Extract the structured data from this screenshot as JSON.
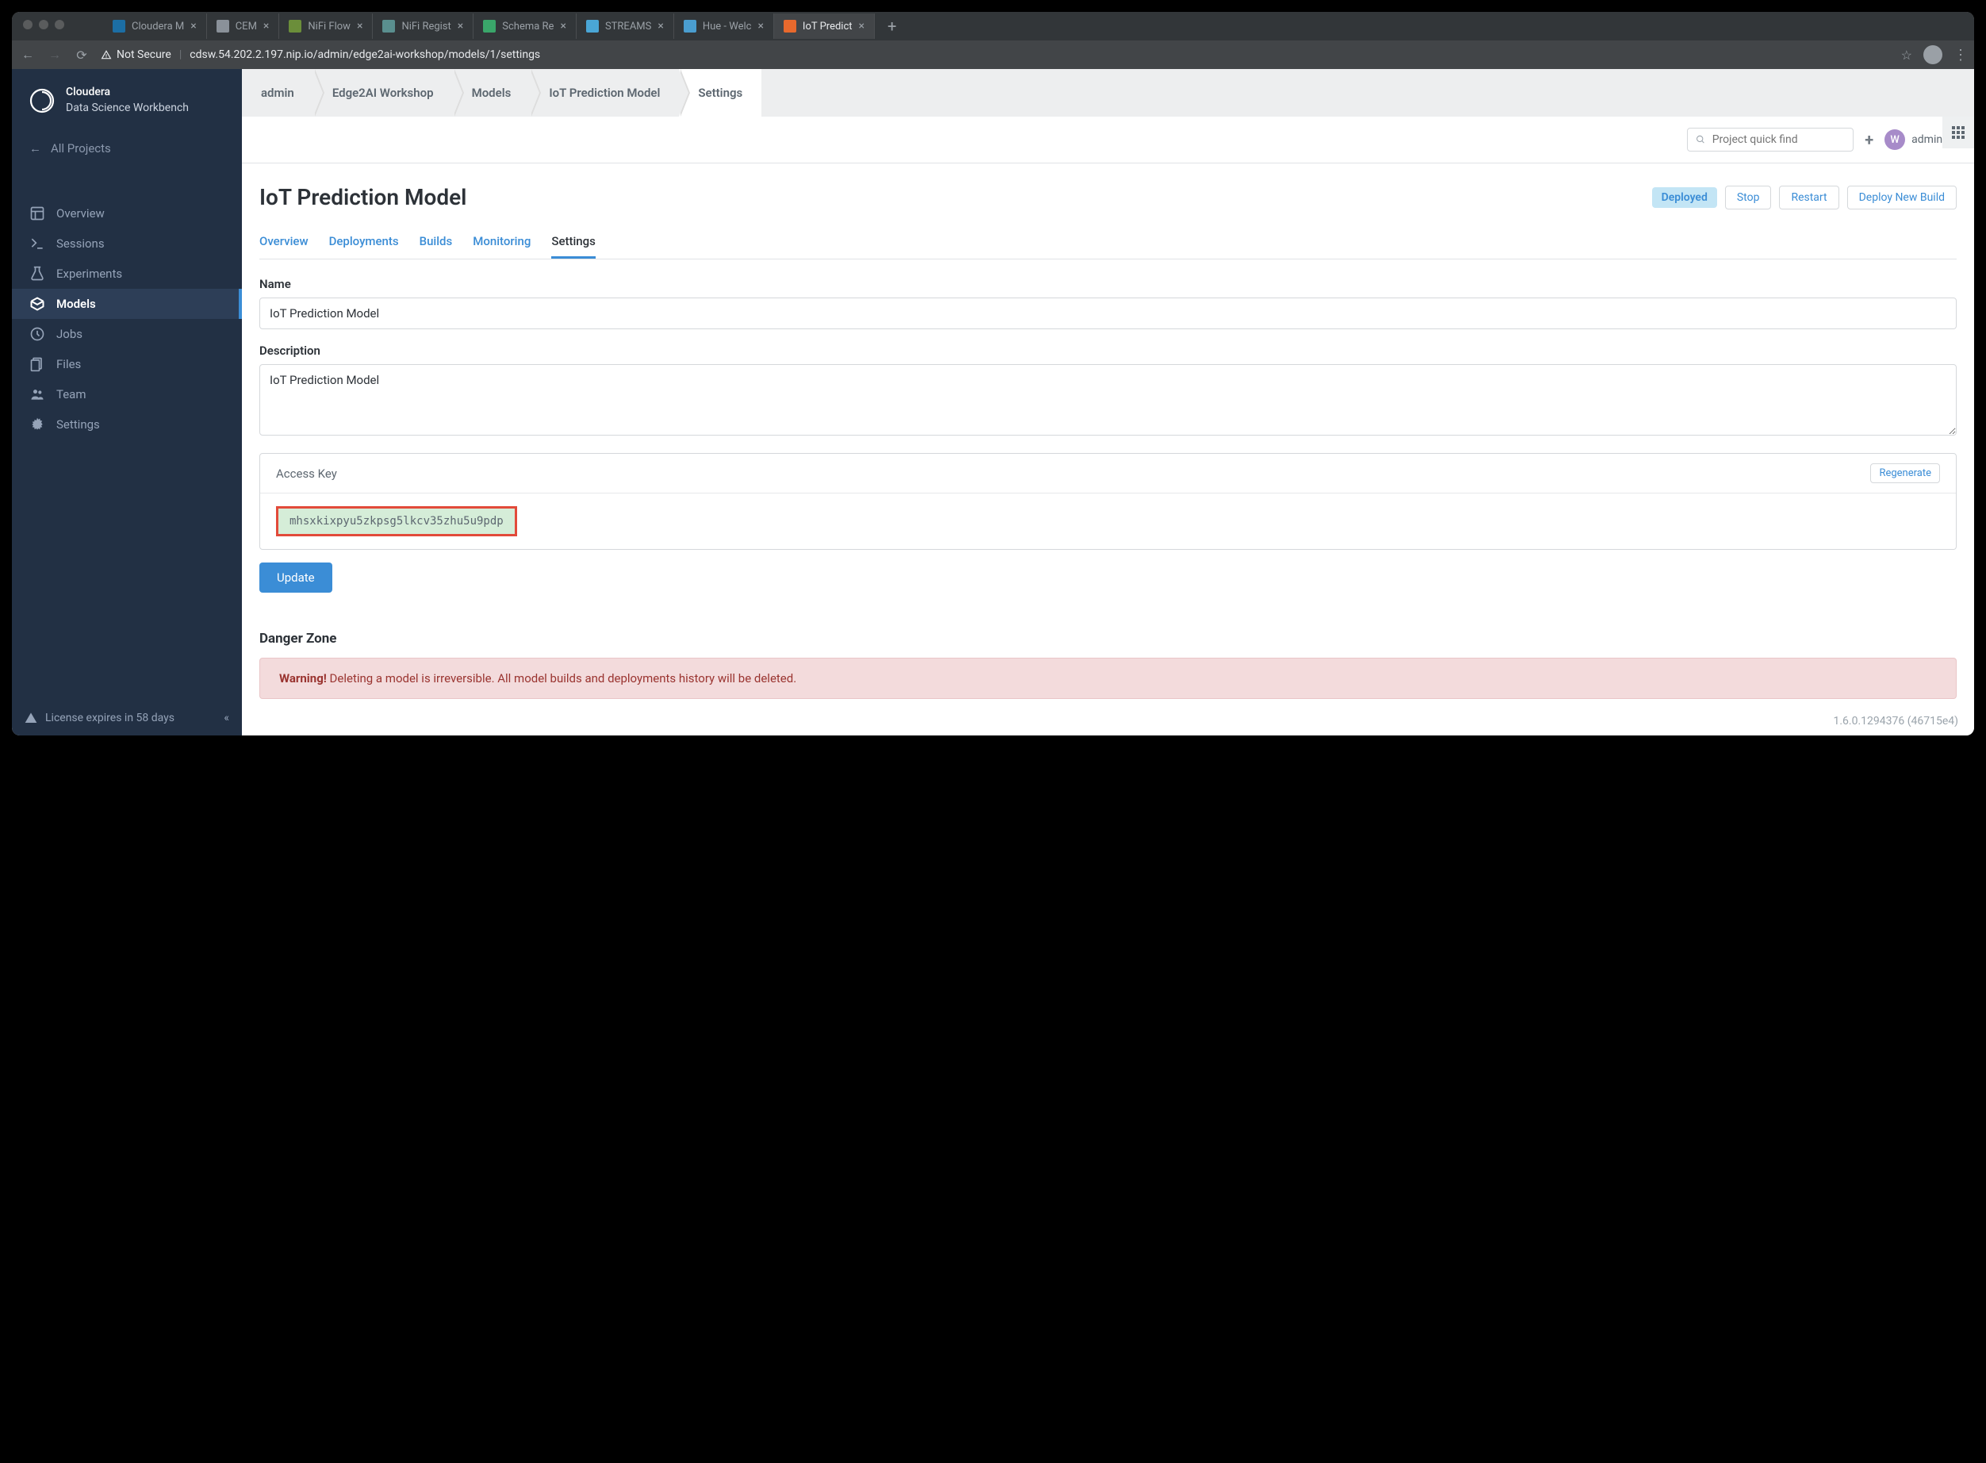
{
  "browser": {
    "tabs": [
      {
        "title": "Cloudera M",
        "favcolor": "#1c6ea4"
      },
      {
        "title": "CEM",
        "favcolor": "#8a9199"
      },
      {
        "title": "NiFi Flow",
        "favcolor": "#6b8e3a"
      },
      {
        "title": "NiFi Regist",
        "favcolor": "#5a8f8f"
      },
      {
        "title": "Schema Re",
        "favcolor": "#3aa66a"
      },
      {
        "title": "STREAMS",
        "favcolor": "#4aa6d6"
      },
      {
        "title": "Hue - Welc",
        "favcolor": "#4a9dcf"
      },
      {
        "title": "IoT Predict",
        "favcolor": "#e8692d",
        "active": true
      }
    ],
    "not_secure": "Not Secure",
    "url": "cdsw.54.202.2.197.nip.io/admin/edge2ai-workshop/models/1/settings"
  },
  "brand": {
    "line1": "Cloudera",
    "line2": "Data Science Workbench"
  },
  "all_projects": "All Projects",
  "sidebar": {
    "items": [
      {
        "label": "Overview",
        "icon": "overview"
      },
      {
        "label": "Sessions",
        "icon": "sessions"
      },
      {
        "label": "Experiments",
        "icon": "experiments"
      },
      {
        "label": "Models",
        "icon": "models",
        "active": true
      },
      {
        "label": "Jobs",
        "icon": "jobs"
      },
      {
        "label": "Files",
        "icon": "files"
      },
      {
        "label": "Team",
        "icon": "team"
      },
      {
        "label": "Settings",
        "icon": "settings"
      }
    ]
  },
  "license": "License expires in 58 days",
  "breadcrumbs": [
    "admin",
    "Edge2AI Workshop",
    "Models",
    "IoT Prediction Model",
    "Settings"
  ],
  "search_placeholder": "Project quick find",
  "user": {
    "initial": "W",
    "name": "admin"
  },
  "page": {
    "title": "IoT Prediction Model",
    "status": "Deployed",
    "actions": {
      "stop": "Stop",
      "restart": "Restart",
      "deploy": "Deploy New Build"
    },
    "tabs": [
      "Overview",
      "Deployments",
      "Builds",
      "Monitoring",
      "Settings"
    ],
    "active_tab": "Settings",
    "form": {
      "name_label": "Name",
      "name_value": "IoT Prediction Model",
      "desc_label": "Description",
      "desc_value": "IoT Prediction Model",
      "access_key_label": "Access Key",
      "regenerate": "Regenerate",
      "access_key": "mhsxkixpyu5zkpsg5lkcv35zhu5u9pdp",
      "update": "Update"
    },
    "danger": {
      "header": "Danger Zone",
      "warning_strong": "Warning!",
      "warning_text": " Deleting a model is irreversible. All model builds and deployments history will be deleted."
    }
  },
  "footer": "1.6.0.1294376 (46715e4)"
}
